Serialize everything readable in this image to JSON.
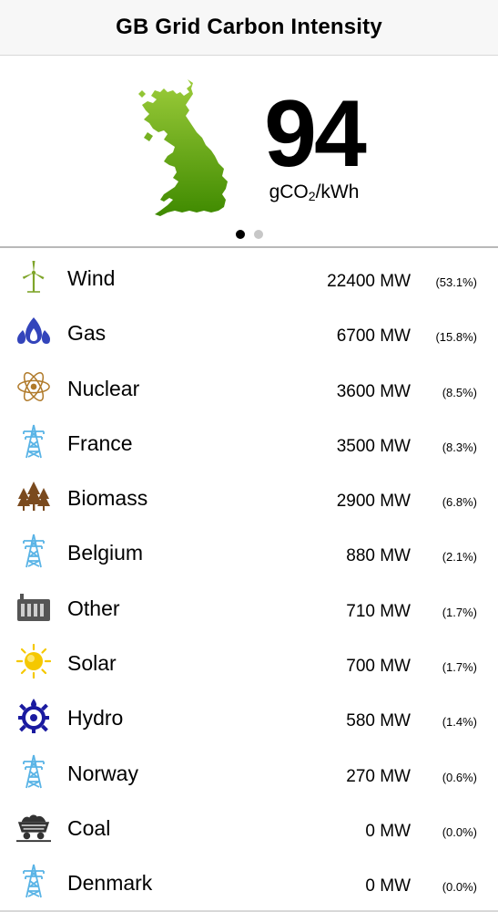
{
  "nav": {
    "title": "GB Grid Carbon Intensity"
  },
  "hero": {
    "map_icon": "great-britain-map-icon",
    "intensity_value": "94",
    "unit_main": "gCO",
    "unit_sub": "2",
    "unit_tail": "/kWh",
    "page_count": 2,
    "active_page": 0
  },
  "colors": {
    "wind": "#7fa52a",
    "gas": "#3344bb",
    "nuclear": "#b07a2a",
    "interconnector": "#5ab4e6",
    "biomass": "#7a4a1e",
    "other": "#555555",
    "solar": "#f5c800",
    "hydro": "#1a1aa0",
    "coal": "#333333",
    "map_green": "#5c9e0a"
  },
  "sources": [
    {
      "name": "Wind",
      "mw": "22400 MW",
      "pct": "(53.1%)",
      "icon": "wind-turbine-icon"
    },
    {
      "name": "Gas",
      "mw": "6700 MW",
      "pct": "(15.8%)",
      "icon": "gas-flame-icon"
    },
    {
      "name": "Nuclear",
      "mw": "3600 MW",
      "pct": "(8.5%)",
      "icon": "atom-icon"
    },
    {
      "name": "France",
      "mw": "3500 MW",
      "pct": "(8.3%)",
      "icon": "pylon-icon"
    },
    {
      "name": "Biomass",
      "mw": "2900 MW",
      "pct": "(6.8%)",
      "icon": "trees-icon"
    },
    {
      "name": "Belgium",
      "mw": "880 MW",
      "pct": "(2.1%)",
      "icon": "pylon-icon"
    },
    {
      "name": "Other",
      "mw": "710 MW",
      "pct": "(1.7%)",
      "icon": "factory-icon"
    },
    {
      "name": "Solar",
      "mw": "700 MW",
      "pct": "(1.7%)",
      "icon": "sun-icon"
    },
    {
      "name": "Hydro",
      "mw": "580 MW",
      "pct": "(1.4%)",
      "icon": "water-wheel-icon"
    },
    {
      "name": "Norway",
      "mw": "270 MW",
      "pct": "(0.6%)",
      "icon": "pylon-icon"
    },
    {
      "name": "Coal",
      "mw": "0 MW",
      "pct": "(0.0%)",
      "icon": "coal-cart-icon"
    },
    {
      "name": "Denmark",
      "mw": "0 MW",
      "pct": "(0.0%)",
      "icon": "pylon-icon"
    }
  ]
}
